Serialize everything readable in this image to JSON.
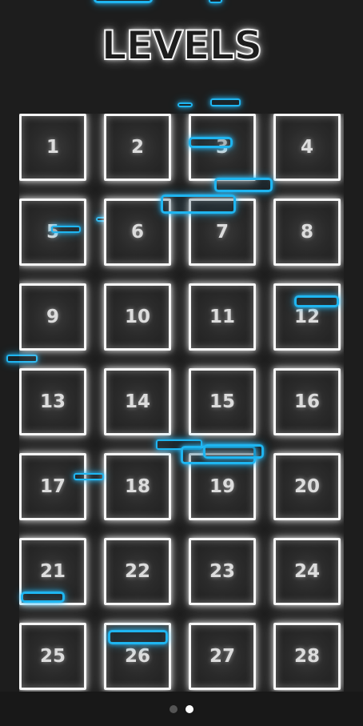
{
  "screen": {
    "title": "LEVELS"
  },
  "levels": [
    "1",
    "2",
    "3",
    "4",
    "5",
    "6",
    "7",
    "8",
    "9",
    "10",
    "11",
    "12",
    "13",
    "14",
    "15",
    "16",
    "17",
    "18",
    "19",
    "20",
    "21",
    "22",
    "23",
    "24",
    "25",
    "26",
    "27",
    "28"
  ],
  "pager": {
    "pages": 2,
    "active_page": 2
  },
  "colors": {
    "background": "#1d1d1d",
    "tile_border": "#f7f7f7",
    "neon_blue": "#1fb5f0",
    "dot_inactive": "#555555",
    "dot_active": "#ffffff"
  }
}
